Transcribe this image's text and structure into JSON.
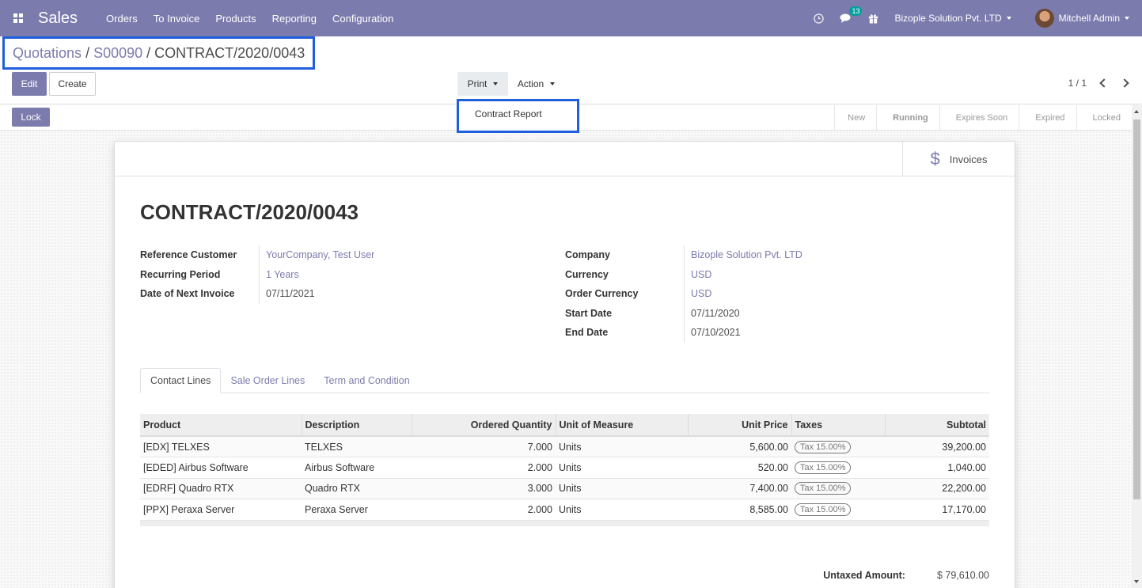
{
  "nav": {
    "brand": "Sales",
    "menu": [
      "Orders",
      "To Invoice",
      "Products",
      "Reporting",
      "Configuration"
    ],
    "chat_count": "13",
    "company": "Bizople Solution Pvt. LTD",
    "user": "Mitchell Admin"
  },
  "breadcrumb": {
    "parent": "Quotations",
    "sep": " / ",
    "middle": "S00090",
    "current": "CONTRACT/2020/0043"
  },
  "toolbar": {
    "edit": "Edit",
    "create": "Create",
    "print": "Print",
    "action": "Action",
    "pager": "1 / 1"
  },
  "print_menu": {
    "items": [
      "Contract Report"
    ]
  },
  "statusbar": {
    "lock": "Lock",
    "stages": [
      "New",
      "Running",
      "Expires Soon",
      "Expired",
      "Locked"
    ],
    "active_stage": "Running"
  },
  "smart_button": {
    "label": "Invoices"
  },
  "record": {
    "title": "CONTRACT/2020/0043",
    "left": [
      {
        "label": "Reference Customer",
        "value": "YourCompany, Test User",
        "link": true
      },
      {
        "label": "Recurring Period",
        "value": "1 Years",
        "link": true
      },
      {
        "label": "Date of Next Invoice",
        "value": "07/11/2021",
        "link": false
      }
    ],
    "right": [
      {
        "label": "Company",
        "value": "Bizople Solution Pvt. LTD",
        "link": true
      },
      {
        "label": "Currency",
        "value": "USD",
        "link": true
      },
      {
        "label": "Order Currency",
        "value": "USD",
        "link": true
      },
      {
        "label": "Start Date",
        "value": "07/11/2020",
        "link": false
      },
      {
        "label": "End Date",
        "value": "07/10/2021",
        "link": false
      }
    ]
  },
  "tabs": [
    "Contact Lines",
    "Sale Order Lines",
    "Term and Condition"
  ],
  "lines": {
    "headers": [
      "Product",
      "Description",
      "Ordered Quantity",
      "Unit of Measure",
      "Unit Price",
      "Taxes",
      "Subtotal"
    ],
    "rows": [
      [
        "[EDX] TELXES",
        "TELXES",
        "7.000",
        "Units",
        "5,600.00",
        "Tax 15.00%",
        "39,200.00"
      ],
      [
        "[EDED] Airbus Software",
        "Airbus Software",
        "2.000",
        "Units",
        "520.00",
        "Tax 15.00%",
        "1,040.00"
      ],
      [
        "[EDRF] Quadro RTX",
        "Quadro RTX",
        "3.000",
        "Units",
        "7,400.00",
        "Tax 15.00%",
        "22,200.00"
      ],
      [
        "[PPX] Peraxa Server",
        "Peraxa Server",
        "2.000",
        "Units",
        "8,585.00",
        "Tax 15.00%",
        "17,170.00"
      ]
    ]
  },
  "totals": {
    "untaxed_label": "Untaxed Amount:",
    "untaxed_value": "$ 79,610.00"
  },
  "colors": {
    "brand": "#7c7bad",
    "highlight": "#1f5fdb"
  }
}
